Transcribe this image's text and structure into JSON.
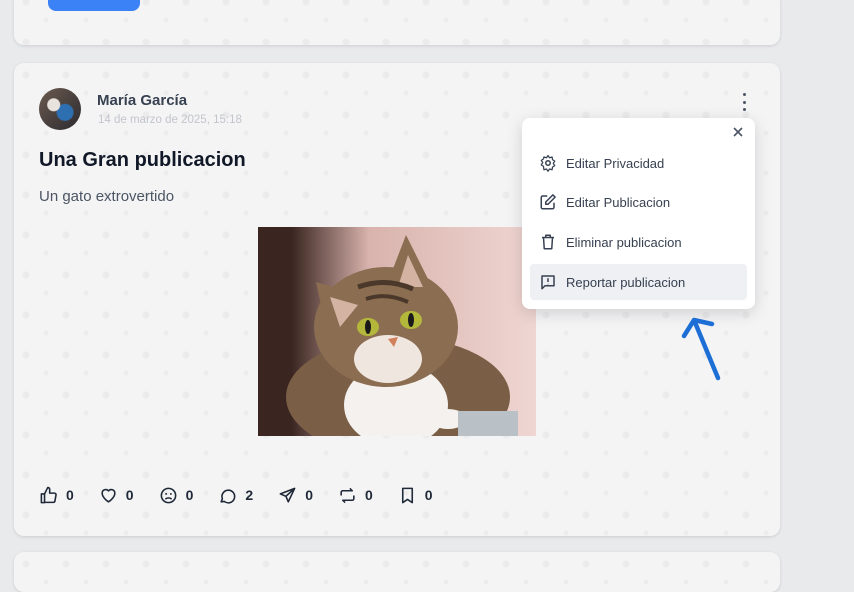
{
  "post": {
    "author": "María García",
    "date": "14 de marzo de 2025, 15:18",
    "title": "Una Gran publicacion",
    "description": "Un gato extrovertido"
  },
  "actions": [
    {
      "icon": "thumbs-up-icon",
      "count": "0"
    },
    {
      "icon": "heart-icon",
      "count": "0"
    },
    {
      "icon": "sad-face-icon",
      "count": "0"
    },
    {
      "icon": "comment-icon",
      "count": "2"
    },
    {
      "icon": "send-icon",
      "count": "0"
    },
    {
      "icon": "repost-icon",
      "count": "0"
    },
    {
      "icon": "bookmark-icon",
      "count": "0"
    }
  ],
  "menu": {
    "items": [
      {
        "label": "Editar Privacidad",
        "icon": "gear-icon"
      },
      {
        "label": "Editar Publicacion",
        "icon": "edit-icon"
      },
      {
        "label": "Eliminar publicacion",
        "icon": "trash-icon"
      },
      {
        "label": "Reportar publicacion",
        "icon": "report-icon"
      }
    ],
    "highlighted": "Reportar publicacion"
  },
  "colors": {
    "accent_button": "#3b82f6",
    "annotation_arrow": "#1d6fd6"
  }
}
